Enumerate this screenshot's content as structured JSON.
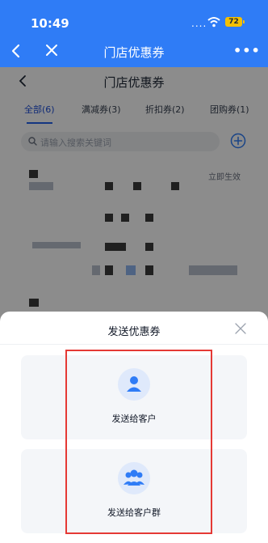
{
  "status_bar": {
    "time": "10:49",
    "signal_dots": "....",
    "battery": "72"
  },
  "nav_bar": {
    "back_icon": "chevron-left-icon",
    "close_icon": "close-icon",
    "title": "门店优惠券",
    "more_label": "•••"
  },
  "page": {
    "title": "门店优惠券",
    "tabs": [
      {
        "label": "全部(6)"
      },
      {
        "label": "满减券(3)"
      },
      {
        "label": "折扣券(2)"
      },
      {
        "label": "团购券(1)"
      }
    ],
    "search_placeholder": "请输入搜索关键词",
    "card_tag": "立即生效"
  },
  "sheet": {
    "title": "发送优惠券",
    "options": [
      {
        "label": "发送给客户",
        "icon": "user-icon"
      },
      {
        "label": "发送给客户群",
        "icon": "group-icon"
      }
    ]
  },
  "colors": {
    "brand_blue": "#2f7cf6",
    "tab_active": "#1d4ed8",
    "highlight_red": "#e53935",
    "icon_blue": "#2f7cf6"
  }
}
